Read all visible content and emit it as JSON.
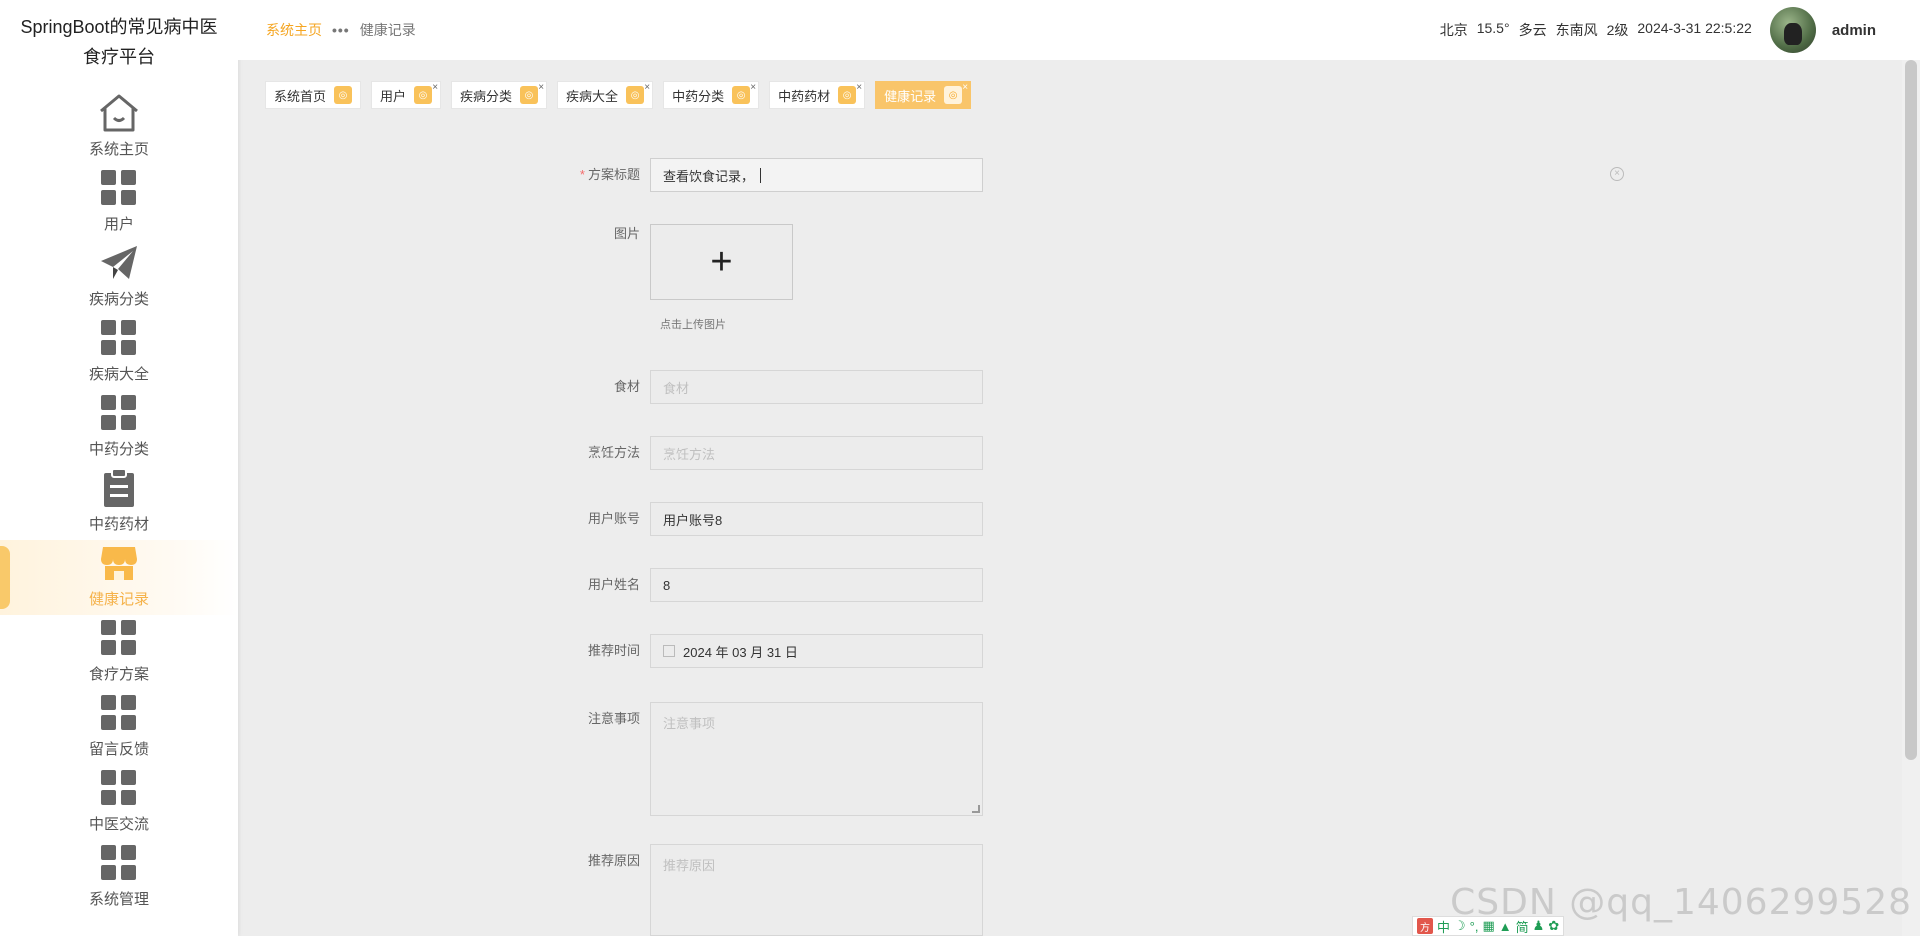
{
  "brand": {
    "line1": "SpringBoot的常见病中医",
    "line2": "食疗平台"
  },
  "sidebar": {
    "items": [
      {
        "label": "系统主页",
        "icon": "home-icon"
      },
      {
        "label": "用户",
        "icon": "grid-icon"
      },
      {
        "label": "疾病分类",
        "icon": "paper-plane-icon"
      },
      {
        "label": "疾病大全",
        "icon": "grid-icon"
      },
      {
        "label": "中药分类",
        "icon": "grid-icon"
      },
      {
        "label": "中药药材",
        "icon": "clipboard-icon"
      },
      {
        "label": "健康记录",
        "icon": "shop-icon",
        "active": true
      },
      {
        "label": "食疗方案",
        "icon": "grid-icon"
      },
      {
        "label": "留言反馈",
        "icon": "grid-icon"
      },
      {
        "label": "中医交流",
        "icon": "grid-icon"
      },
      {
        "label": "系统管理",
        "icon": "grid-icon"
      }
    ]
  },
  "breadcrumb": {
    "home": "系统主页",
    "separator": "•••",
    "current": "健康记录"
  },
  "header": {
    "city": "北京",
    "temp": "15.5°",
    "weather": "多云",
    "wind": "东南风",
    "wind_level": "2级",
    "datetime": "2024-3-31 22:5:22",
    "username": "admin"
  },
  "tabs": [
    {
      "label": "系统首页",
      "closable": false
    },
    {
      "label": "用户",
      "closable": true
    },
    {
      "label": "疾病分类",
      "closable": true
    },
    {
      "label": "疾病大全",
      "closable": true
    },
    {
      "label": "中药分类",
      "closable": true
    },
    {
      "label": "中药药材",
      "closable": true
    },
    {
      "label": "健康记录",
      "closable": true,
      "active": true
    }
  ],
  "form": {
    "title": {
      "label": "方案标题",
      "required_mark": "*",
      "value": "查看饮食记录，"
    },
    "image": {
      "label": "图片",
      "plus": "+",
      "hint": "点击上传图片"
    },
    "ingredients": {
      "label": "食材",
      "placeholder": "食材"
    },
    "cooking": {
      "label": "烹饪方法",
      "placeholder": "烹饪方法"
    },
    "account": {
      "label": "用户账号",
      "value": "用户账号8"
    },
    "name": {
      "label": "用户姓名",
      "value": "8"
    },
    "date": {
      "label": "推荐时间",
      "value": "2024 年 03 月 31 日"
    },
    "notes": {
      "label": "注意事项",
      "placeholder": "注意事项"
    },
    "reason": {
      "label": "推荐原因",
      "placeholder": "推荐原因"
    }
  },
  "ime": {
    "logo": "方",
    "items": [
      "中",
      "☽",
      "°,",
      "▦",
      "▲",
      "简",
      "♟",
      "✿"
    ]
  },
  "watermark": "CSDN @qq_1406299528",
  "colors": {
    "accent": "#f5a623",
    "active_tab": "#f9c56a",
    "required": "#f56c6c"
  }
}
